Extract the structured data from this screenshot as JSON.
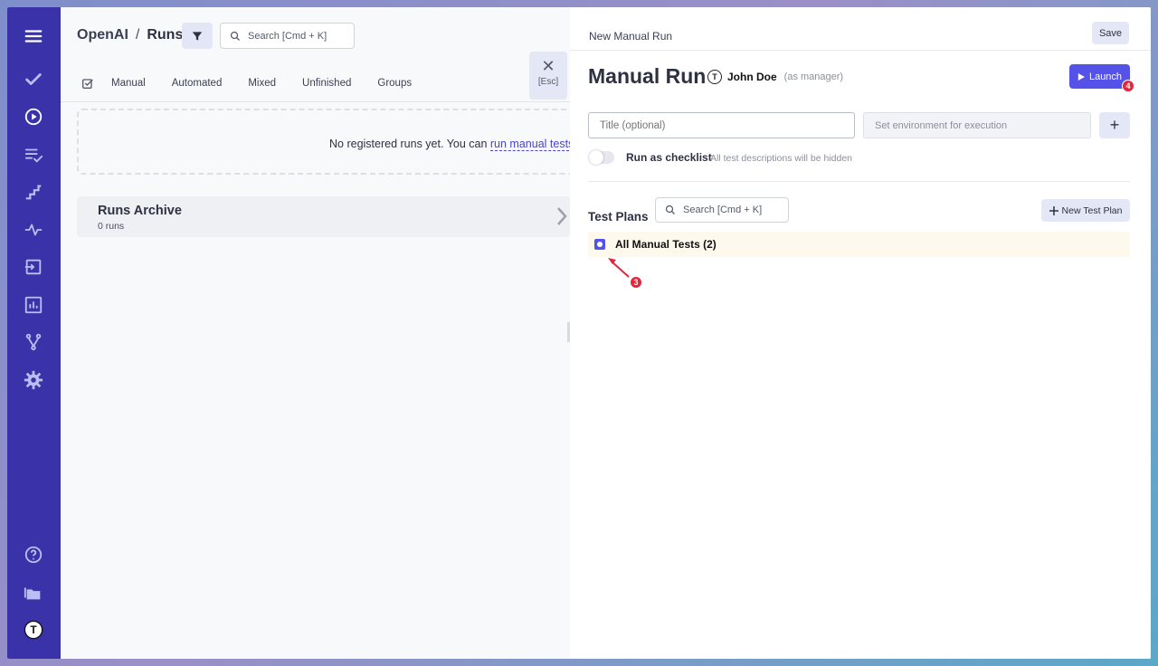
{
  "sidebar": {
    "icons": [
      "menu-icon",
      "check-icon",
      "play-circle-icon",
      "list-check-icon",
      "steps-icon",
      "pulse-icon",
      "import-icon",
      "bar-chart-icon",
      "branch-icon",
      "gear-icon",
      "help-icon",
      "folders-icon",
      "user-avatar-icon"
    ],
    "avatar_letter": "T"
  },
  "header": {
    "org": "OpenAI",
    "separator": "/",
    "page": "Runs",
    "search_placeholder": "Search [Cmd + K]"
  },
  "tabs": [
    "Manual",
    "Automated",
    "Mixed",
    "Unfinished",
    "Groups"
  ],
  "close": {
    "symbol": "✕",
    "key_hint": "[Esc]"
  },
  "empty_state": {
    "text": "No registered runs yet. You can ",
    "link": "run manual tests"
  },
  "archive": {
    "title": "Runs Archive",
    "count": "0 runs"
  },
  "panel": {
    "header_title": "New Manual Run",
    "save_label": "Save",
    "run_title": "Manual Run",
    "user_name": "John Doe",
    "user_role": "(as manager)",
    "launch_label": "Launch",
    "launch_badge": "4",
    "title_placeholder": "Title (optional)",
    "env_placeholder": "Set environment for execution",
    "add_symbol": "+",
    "checklist_label": "Run as checklist",
    "checklist_hint": "All test descriptions will be hidden",
    "test_plans_label": "Test Plans",
    "plans_search_placeholder": "Search [Cmd + K]",
    "new_plan_label": "New Test Plan",
    "plan_item": "All Manual Tests (2)",
    "plan_badge": "3"
  },
  "colors": {
    "sidebar": "#3a32a8",
    "accent": "#5452e8",
    "badge": "#e5253a",
    "row_highlight": "#fdf9ec"
  }
}
